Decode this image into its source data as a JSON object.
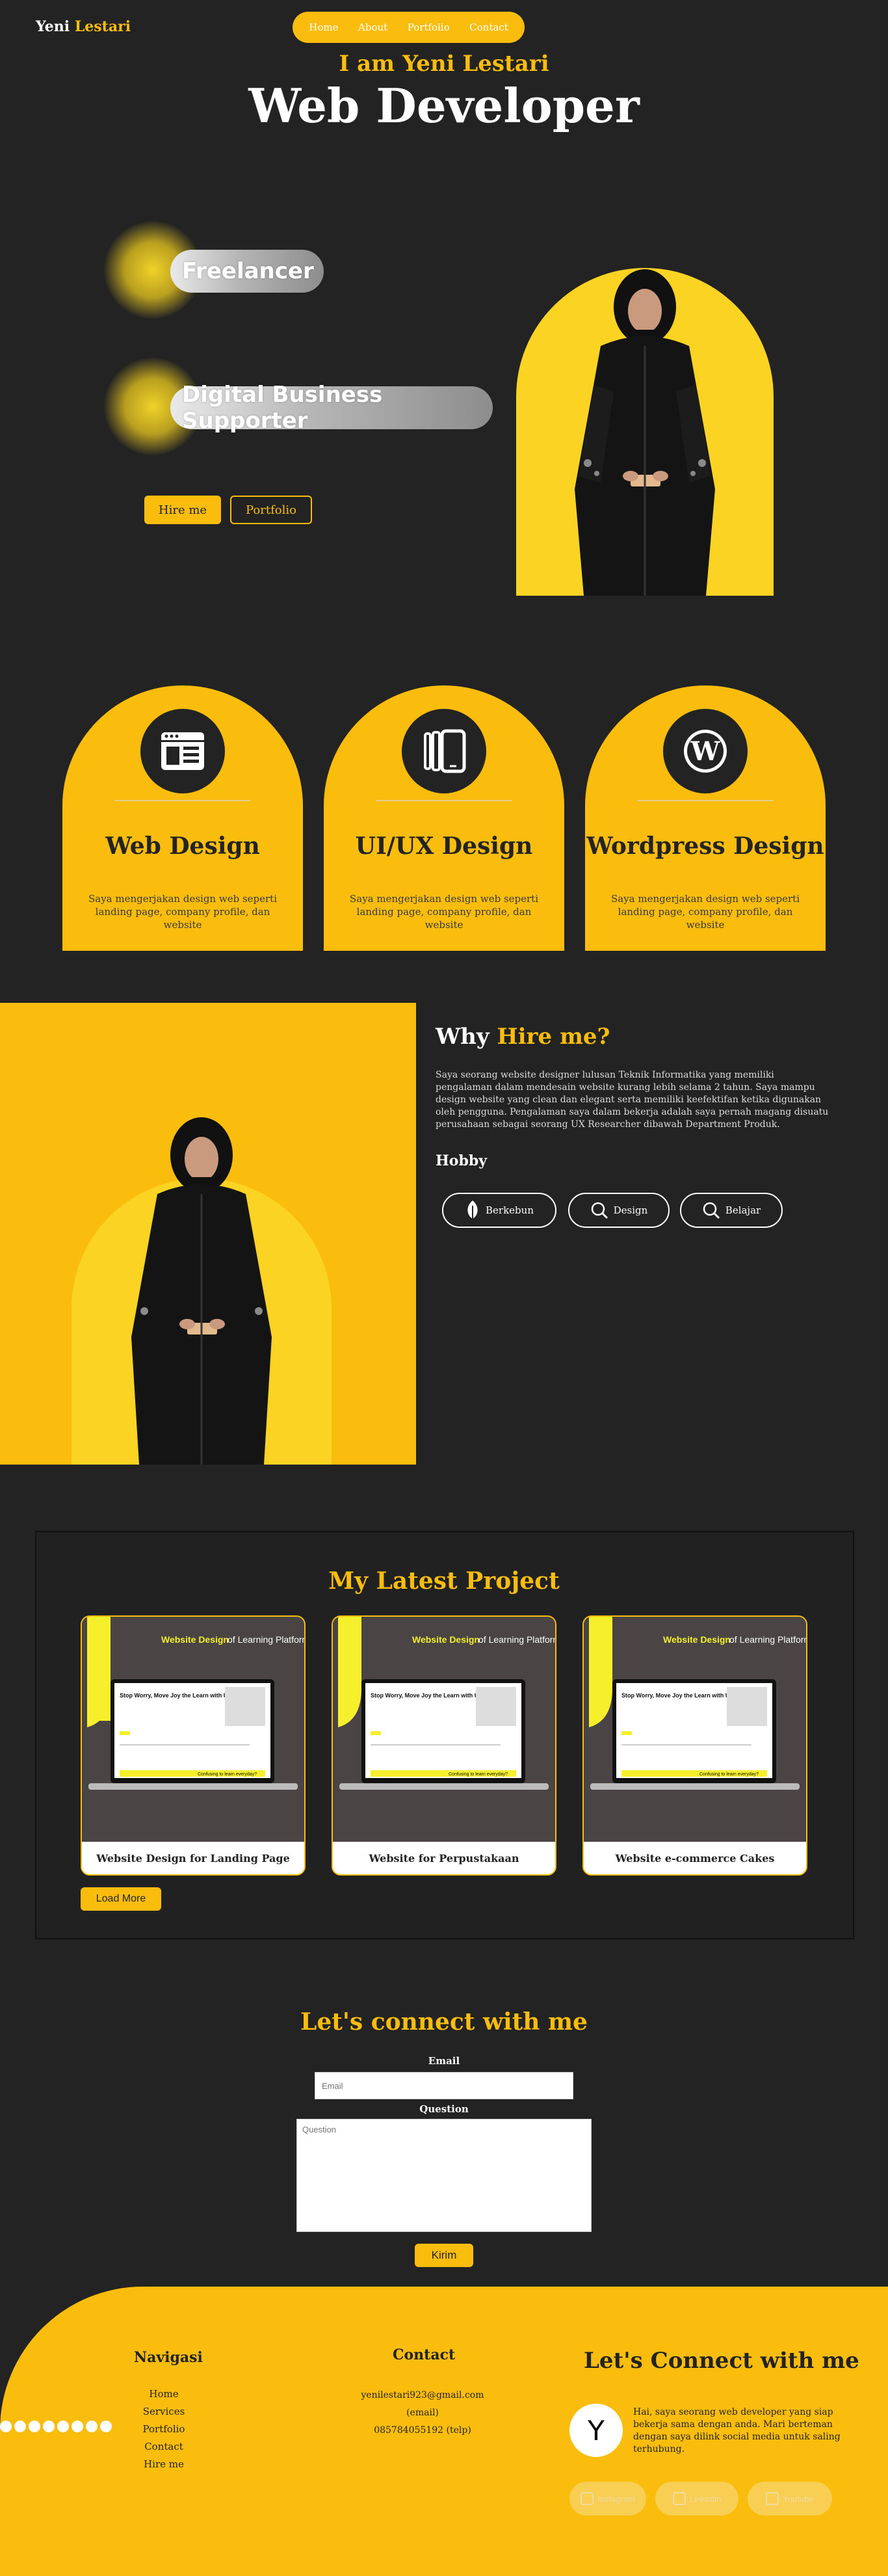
{
  "nav": {
    "logo_first": "Yeni",
    "logo_last": "Lestari",
    "links": [
      "Home",
      "About",
      "Portfolio",
      "Contact"
    ]
  },
  "hero": {
    "intro": "I am Yeni Lestari",
    "title": "Web Developer",
    "roles": [
      "Freelancer",
      "Digital Business Supporter"
    ],
    "buttons": {
      "hire": "Hire me",
      "portfolio": "Portfolio"
    }
  },
  "services": [
    {
      "title": "Web Design",
      "desc": "Saya mengerjakan design web seperti landing page, company profile, dan website",
      "icon": "browser-layout-icon"
    },
    {
      "title": "UI/UX Design",
      "desc": "Saya mengerjakan design web seperti landing page, company profile, dan website",
      "icon": "mobile-devices-icon"
    },
    {
      "title": "Wordpress Design",
      "desc": "Saya mengerjakan design web seperti landing page, company profile, dan website",
      "icon": "wordpress-icon"
    }
  ],
  "about": {
    "title_plain": "Why",
    "title_accent": "Hire me?",
    "text": "Saya seorang website designer lulusan Teknik Informatika yang memiliki pengalaman dalam mendesain website kurang lebih selama 2 tahun. Saya mampu design website yang clean dan elegant serta memiliki keefektifan ketika digunakan oleh pengguna. Pengalaman saya dalam bekerja adalah saya pernah magang disuatu perusahaan sebagai seorang UX Researcher dibawah Department Produk.",
    "hobby_title": "Hobby",
    "hobbies": [
      "Berkebun",
      "Design",
      "Belajar"
    ]
  },
  "projects": {
    "title": "My Latest Project",
    "thumb": {
      "accent": "Website Design",
      "rest": "of Learning Platform",
      "screen_heading": "Stop Worry, Move Joy the Learn with Us",
      "banner": "Confusing to learn everyday?"
    },
    "items": [
      "Website Design for Landing Page",
      "Website for Perpustakaan",
      "Website e-commerce Cakes"
    ],
    "load_more": "Load More"
  },
  "contact_form": {
    "title": "Let's connect with me",
    "email_label": "Email",
    "email_placeholder": "Email",
    "question_label": "Question",
    "question_placeholder": "Question",
    "submit": "Kirim"
  },
  "footer": {
    "nav_title": "Navigasi",
    "nav_links": [
      "Home",
      "Services",
      "Portfolio",
      "Contact",
      "Hire me"
    ],
    "contact_title": "Contact",
    "email": "yenilestari923@gmail.com (email)",
    "phone": "085784055192 (telp)",
    "connect_title": "Let's Connect with me",
    "avatar_letter": "Y",
    "connect_text": "Hai, saya seorang web developer yang siap bekerja sama dengan anda. Mari berteman dengan saya dilink social media untuk saling terhubung.",
    "socials": [
      "Instagram",
      "Linkedin",
      "Youtube"
    ]
  },
  "colors": {
    "accent": "#fbbd0d",
    "background": "#232323",
    "arch": "#fbd423"
  }
}
